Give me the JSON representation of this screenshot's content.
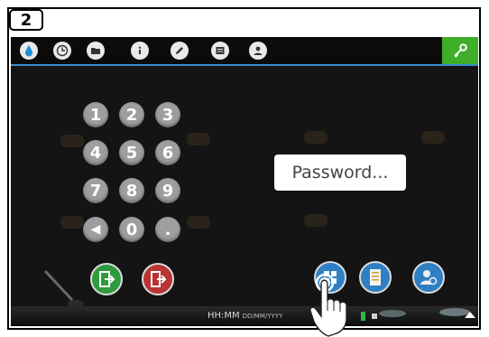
{
  "step": {
    "number": "2"
  },
  "topbar": {
    "icons": [
      "water-drop-icon",
      "clock-icon",
      "folder-icon",
      "info-icon",
      "pencil-icon",
      "document-icon",
      "user-icon"
    ],
    "key_icon": "key-icon",
    "accent": "#3fae2a"
  },
  "keypad": {
    "keys": [
      "1",
      "2",
      "3",
      "4",
      "5",
      "6",
      "7",
      "8",
      "9",
      "◀",
      "0",
      "."
    ]
  },
  "password": {
    "placeholder": "Password..."
  },
  "actions": {
    "login_icon": "login-icon",
    "logout_icon": "logout-icon"
  },
  "dock": {
    "icons": [
      "grid-icon",
      "checklist-icon",
      "user-settings-icon"
    ]
  },
  "status": {
    "time": "HH:MM",
    "date": "DD/MM/YYYY"
  }
}
